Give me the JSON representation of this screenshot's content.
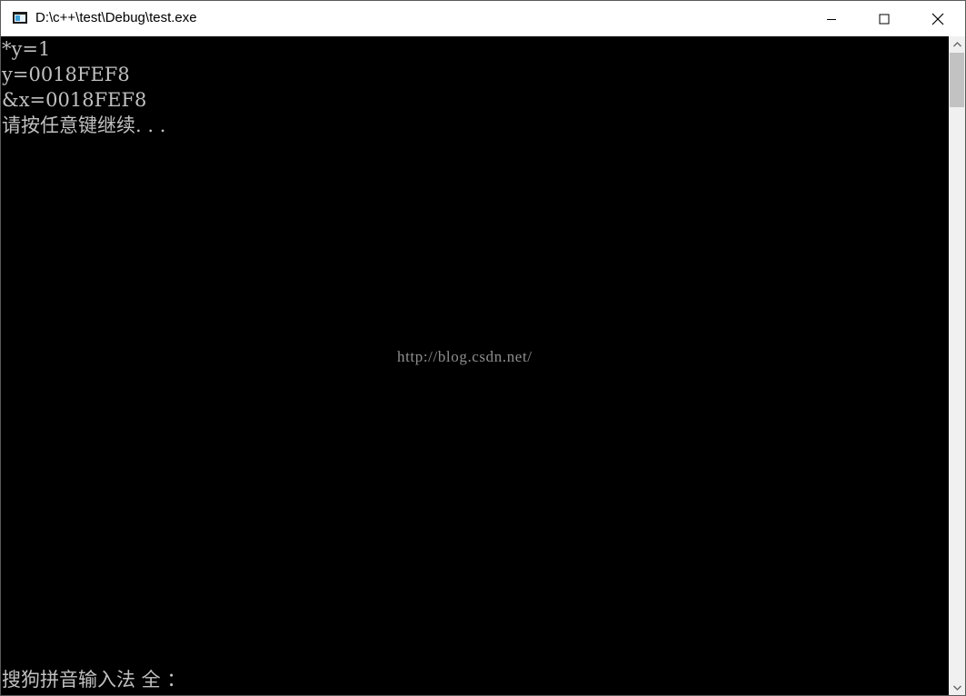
{
  "window": {
    "title": "D:\\c++\\test\\Debug\\test.exe",
    "icon": "console-app-icon"
  },
  "controls": {
    "minimize_icon": "minimize-icon",
    "maximize_icon": "maximize-icon",
    "close_icon": "close-icon"
  },
  "console": {
    "lines": [
      "*y=1",
      "y=0018FEF8",
      "&x=0018FEF8",
      "请按任意键继续. . ."
    ],
    "watermark": "http://blog.csdn.net/",
    "ime_status": "搜狗拼音输入法 全 ：",
    "text_color": "#c0c0c0",
    "background_color": "#000000"
  },
  "scrollbar": {
    "up_icon": "chevron-up-icon",
    "down_icon": "chevron-down-icon"
  }
}
